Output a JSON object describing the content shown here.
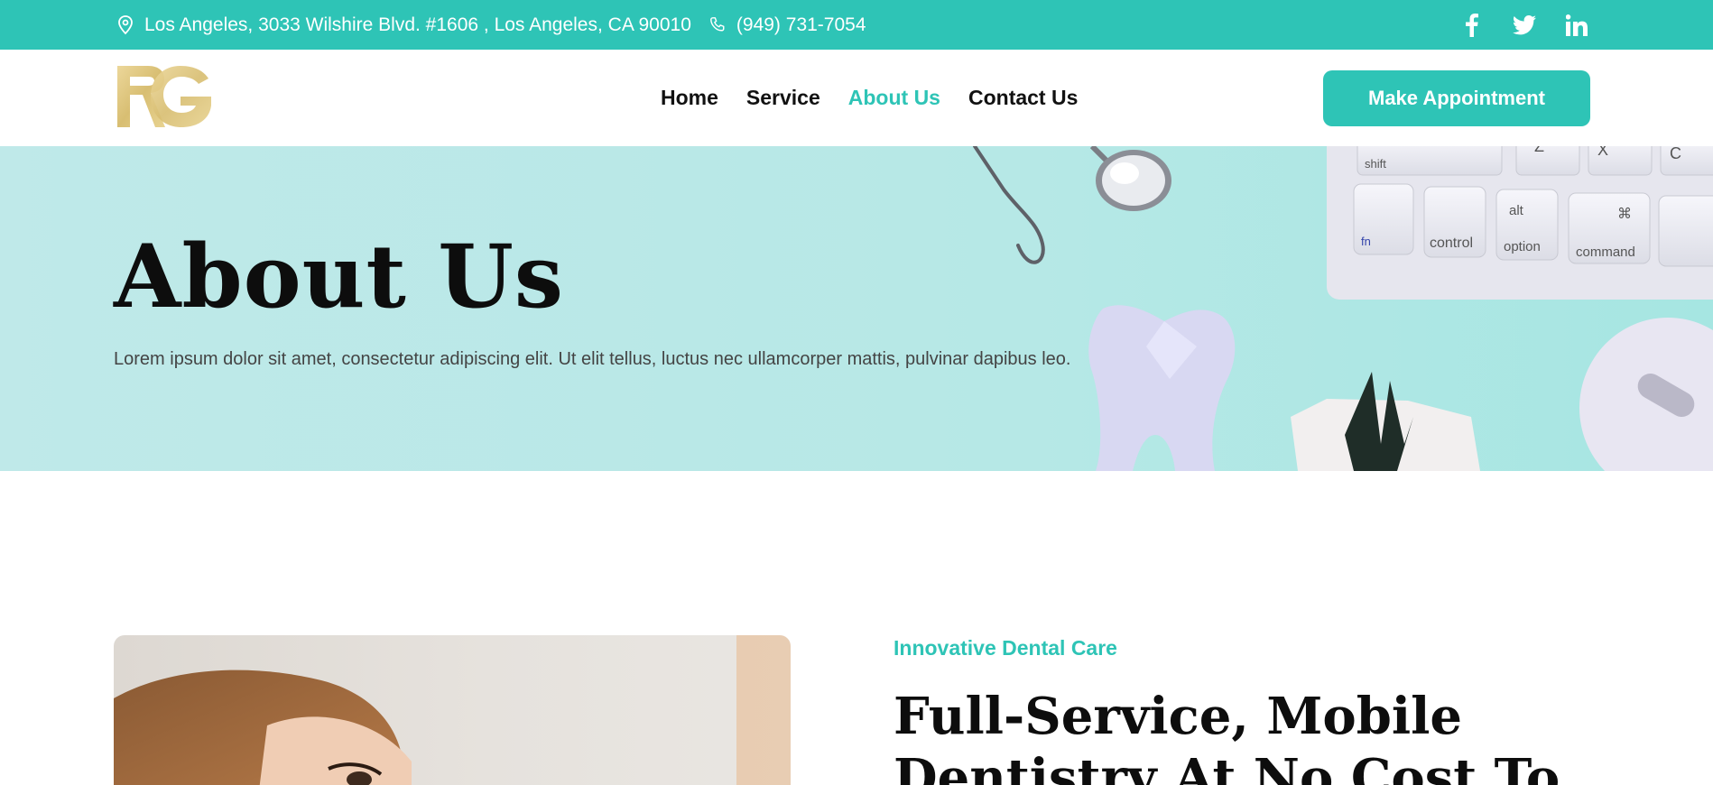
{
  "topbar": {
    "address": "Los Angeles, 3033 Wilshire Blvd. #1606 , Los Angeles, CA 90010",
    "phone": "(949) 731-7054",
    "social_icons": [
      "facebook-icon",
      "twitter-icon",
      "linkedin-icon"
    ],
    "bg_color": "#2ec4b6"
  },
  "header": {
    "logo_text": "RG",
    "nav": [
      "Home",
      "Service",
      "About Us",
      "Contact Us"
    ],
    "active_nav": "About Us",
    "cta_label": "Make Appointment"
  },
  "hero": {
    "title": "About Us",
    "subtitle": "Lorem ipsum dolor sit amet, consectetur adipiscing elit. Ut elit tellus, luctus nec ullamcorper mattis, pulvinar dapibus leo.",
    "keyboard_keys": [
      "shift",
      "fn",
      "control",
      "alt",
      "option",
      "⌘",
      "command",
      "Z",
      "X",
      "C"
    ]
  },
  "section": {
    "eyebrow": "Innovative Dental Care",
    "headline": "Full-Service, Mobile Dentistry At No Cost To"
  },
  "colors": {
    "accent": "#2ec4b6",
    "logo_gold": "#d9c27a",
    "hero_bg": "#b8e8e8"
  }
}
